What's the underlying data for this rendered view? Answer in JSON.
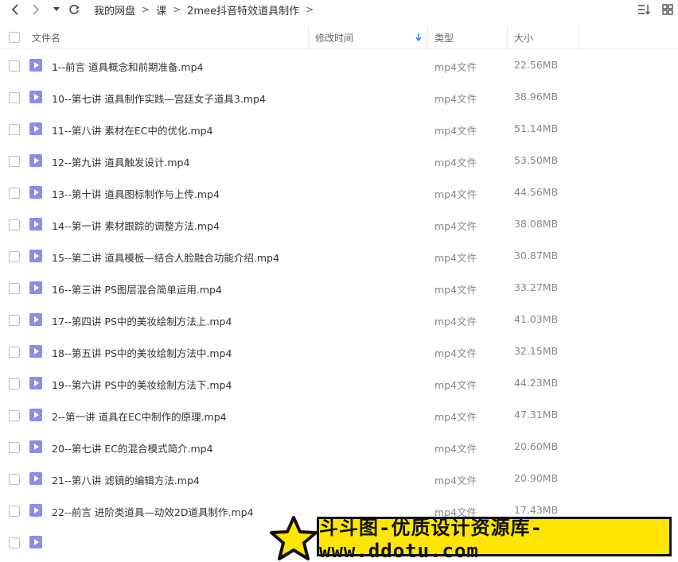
{
  "nav": {
    "breadcrumbs": [
      "我的网盘",
      "课",
      "2mee抖音特效道具制作"
    ],
    "separator": ">"
  },
  "columns": {
    "name": "文件名",
    "modified": "修改时间",
    "type": "类型",
    "size": "大小"
  },
  "files": [
    {
      "name": "1--前言 道具概念和前期准备.mp4",
      "type": "mp4文件",
      "size": "22.56MB"
    },
    {
      "name": "10--第七讲 道具制作实践—宫廷女子道具3.mp4",
      "type": "mp4文件",
      "size": "38.96MB"
    },
    {
      "name": "11--第八讲 素材在EC中的优化.mp4",
      "type": "mp4文件",
      "size": "51.14MB"
    },
    {
      "name": "12--第九讲 道具触发设计.mp4",
      "type": "mp4文件",
      "size": "53.50MB"
    },
    {
      "name": "13--第十讲 道具图标制作与上传.mp4",
      "type": "mp4文件",
      "size": "44.56MB"
    },
    {
      "name": "14--第一讲 素材跟踪的调整方法.mp4",
      "type": "mp4文件",
      "size": "38.08MB"
    },
    {
      "name": "15--第二讲 道具模板—结合人脸融合功能介绍.mp4",
      "type": "mp4文件",
      "size": "30.87MB"
    },
    {
      "name": "16--第三讲 PS图层混合简单运用.mp4",
      "type": "mp4文件",
      "size": "33.27MB"
    },
    {
      "name": "17--第四讲 PS中的美妆绘制方法上.mp4",
      "type": "mp4文件",
      "size": "41.03MB"
    },
    {
      "name": "18--第五讲 PS中的美妆绘制方法中.mp4",
      "type": "mp4文件",
      "size": "32.15MB"
    },
    {
      "name": "19--第六讲 PS中的美妆绘制方法下.mp4",
      "type": "mp4文件",
      "size": "44.23MB"
    },
    {
      "name": "2--第一讲 道具在EC中制作的原理.mp4",
      "type": "mp4文件",
      "size": "47.31MB"
    },
    {
      "name": "20--第七讲 EC的混合模式简介.mp4",
      "type": "mp4文件",
      "size": "20.60MB"
    },
    {
      "name": "21--第八讲 滤镜的编辑方法.mp4",
      "type": "mp4文件",
      "size": "20.90MB"
    },
    {
      "name": "22--前言 进阶类道具—动效2D道具制作.mp4",
      "type": "mp4文件",
      "size": "17.43MB"
    }
  ],
  "watermark": "斗斗图-优质设计资源库-www.ddotu.com",
  "colors": {
    "file_icon": "#8c8cf0",
    "sort_arrow": "#2f7ff5",
    "banner": "#ffe600"
  }
}
